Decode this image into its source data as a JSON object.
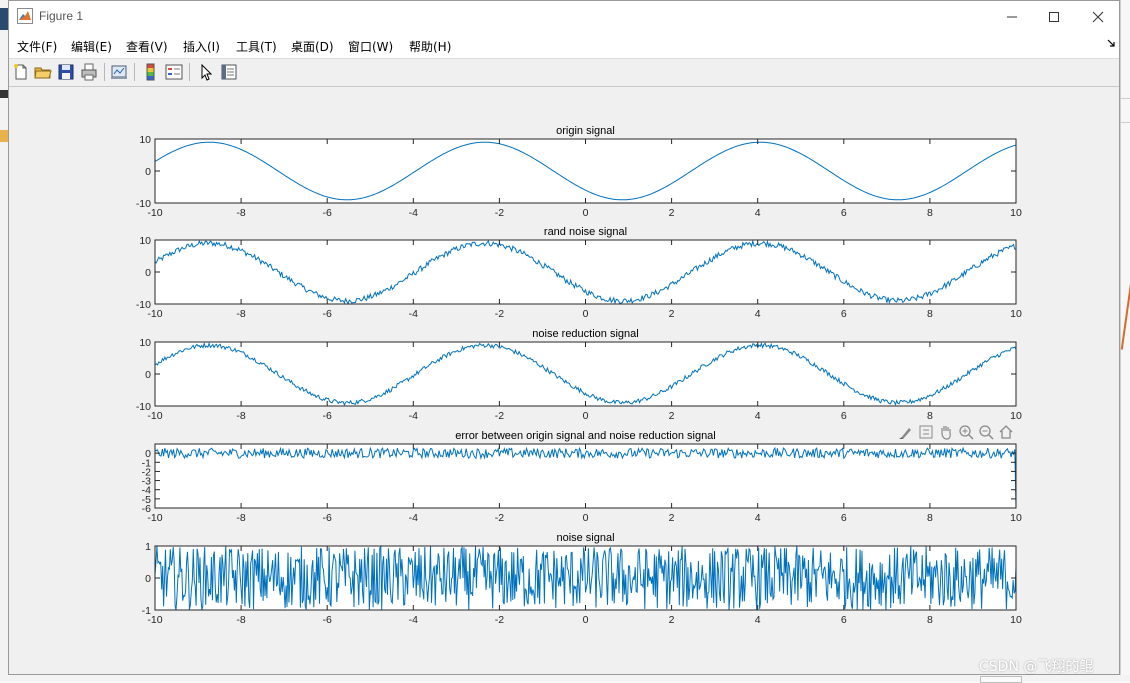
{
  "window": {
    "title": "Figure 1",
    "controls": {
      "minimize": "minimize",
      "maximize": "maximize",
      "close": "close"
    }
  },
  "menubar": {
    "items": [
      "文件(F)",
      "编辑(E)",
      "查看(V)",
      "插入(I)",
      "工具(T)",
      "桌面(D)",
      "窗口(W)",
      "帮助(H)"
    ]
  },
  "toolbar": {
    "buttons": [
      "new-figure-icon",
      "open-file-icon",
      "save-icon",
      "print-icon",
      "link-plot-icon",
      "insert-colorbar-icon",
      "insert-legend-icon",
      "edit-plot-arrow-icon",
      "property-editor-icon"
    ]
  },
  "axes_toolbar": {
    "buttons": [
      "brush-icon",
      "data-tips-icon",
      "pan-hand-icon",
      "zoom-in-icon",
      "zoom-out-icon",
      "restore-view-icon"
    ]
  },
  "colors": {
    "line": "#0072BD",
    "axes_bg": "#ffffff",
    "figure_bg": "#f0f0f0"
  },
  "watermark": "CSDN @飞翔的鲲",
  "chart_data": [
    {
      "type": "line",
      "title": "origin signal",
      "xlim": [
        -10,
        10
      ],
      "ylim": [
        -10,
        10
      ],
      "xticks": [
        -10,
        -8,
        -6,
        -4,
        -2,
        0,
        2,
        4,
        6,
        8,
        10
      ],
      "yticks": [
        -10,
        0,
        10
      ],
      "series": [
        {
          "x": [
            -10,
            -9,
            -8,
            -7,
            -6,
            -5,
            -4,
            -3,
            -2,
            -1,
            0,
            1,
            2,
            3,
            4,
            5,
            6,
            7,
            8,
            9,
            10
          ],
          "y": [
            6,
            -3,
            -9,
            -9,
            -6,
            0,
            6,
            9,
            8,
            3,
            -3,
            -8,
            -9,
            -6,
            0,
            6,
            9,
            8,
            3,
            -3,
            -8
          ]
        }
      ]
    },
    {
      "type": "line",
      "title": "rand noise signal",
      "xlim": [
        -10,
        10
      ],
      "ylim": [
        -10,
        10
      ],
      "xticks": [
        -10,
        -8,
        -6,
        -4,
        -2,
        0,
        2,
        4,
        6,
        8,
        10
      ],
      "yticks": [
        -10,
        0,
        10
      ]
    },
    {
      "type": "line",
      "title": "noise reduction signal",
      "xlim": [
        -10,
        10
      ],
      "ylim": [
        -10,
        10
      ],
      "xticks": [
        -10,
        -8,
        -6,
        -4,
        -2,
        0,
        2,
        4,
        6,
        8,
        10
      ],
      "yticks": [
        -10,
        0,
        10
      ]
    },
    {
      "type": "line",
      "title": "error between origin signal and noise reduction signal",
      "xlim": [
        -10,
        10
      ],
      "ylim": [
        -6,
        1
      ],
      "xticks": [
        -10,
        -8,
        -6,
        -4,
        -2,
        0,
        2,
        4,
        6,
        8,
        10
      ],
      "yticks": [
        -6,
        -5,
        -4,
        -3,
        -2,
        -1,
        0
      ]
    },
    {
      "type": "line",
      "title": "noise signal",
      "xlim": [
        -10,
        10
      ],
      "ylim": [
        -1,
        1
      ],
      "xticks": [
        -10,
        -8,
        -6,
        -4,
        -2,
        0,
        2,
        4,
        6,
        8,
        10
      ],
      "yticks": [
        -1,
        0,
        1
      ]
    }
  ]
}
